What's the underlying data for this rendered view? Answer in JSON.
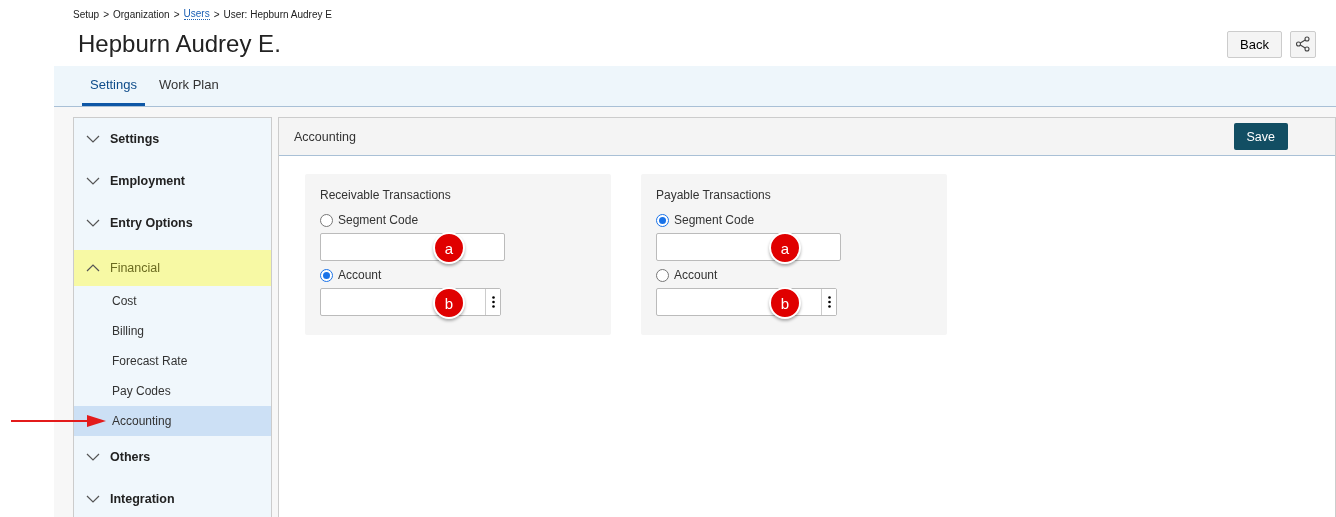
{
  "breadcrumb": [
    {
      "kind": "crumb",
      "label": "Setup"
    },
    {
      "kind": "separator",
      "label": ">"
    },
    {
      "kind": "crumb",
      "label": "Organization"
    },
    {
      "kind": "separator",
      "label": ">"
    },
    {
      "kind": "link",
      "label": "Users"
    },
    {
      "kind": "separator",
      "label": ">"
    },
    {
      "kind": "crumb",
      "label": "User: Hepburn Audrey E"
    }
  ],
  "title": "Hepburn Audrey E.",
  "back_button": "Back",
  "tabs": [
    {
      "label": "Settings",
      "selected": true
    },
    {
      "label": "Work Plan",
      "selected": false
    }
  ],
  "sidebar": {
    "items": [
      {
        "label": "Settings",
        "expanded": false,
        "highlighted": false
      },
      {
        "label": "Employment",
        "expanded": false,
        "highlighted": false
      },
      {
        "label": "Entry Options",
        "expanded": false,
        "highlighted": false
      },
      {
        "label": "Financial",
        "expanded": true,
        "highlighted": true,
        "children": [
          {
            "label": "Cost",
            "selected": false,
            "pointed_at": false
          },
          {
            "label": "Billing",
            "selected": false,
            "pointed_at": false
          },
          {
            "label": "Forecast Rate",
            "selected": false,
            "pointed_at": false
          },
          {
            "label": "Pay Codes",
            "selected": false,
            "pointed_at": false
          },
          {
            "label": "Accounting",
            "selected": true,
            "pointed_at": true
          }
        ]
      },
      {
        "label": "Others",
        "expanded": false,
        "highlighted": false
      },
      {
        "label": "Integration",
        "expanded": false,
        "highlighted": false
      }
    ]
  },
  "panel": {
    "title": "Accounting",
    "save_button": "Save",
    "cards": [
      {
        "title": "Receivable Transactions",
        "options": [
          {
            "label": "Segment Code",
            "selected": false,
            "kind": "text",
            "callout": "a"
          },
          {
            "label": "Account",
            "selected": true,
            "kind": "picker",
            "callout": "b"
          }
        ]
      },
      {
        "title": "Payable Transactions",
        "options": [
          {
            "label": "Segment Code",
            "selected": true,
            "kind": "text",
            "callout": "a"
          },
          {
            "label": "Account",
            "selected": false,
            "kind": "picker",
            "callout": "b"
          }
        ]
      }
    ]
  }
}
